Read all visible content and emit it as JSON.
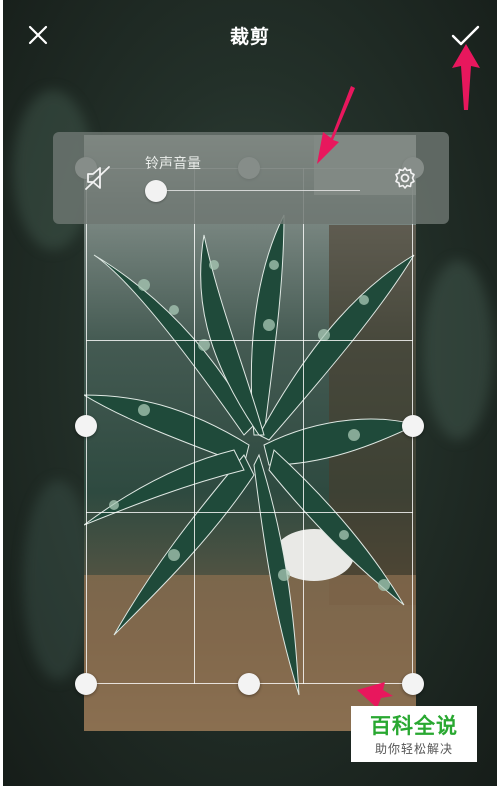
{
  "header": {
    "title": "裁剪",
    "close_icon": "close-icon",
    "confirm_icon": "checkmark-icon"
  },
  "volume_overlay": {
    "label": "铃声音量",
    "mute_icon": "speaker-muted-icon",
    "settings_icon": "gear-icon",
    "level": 0
  },
  "crop": {
    "grid": "3x3",
    "handles": [
      "top-left",
      "top-center",
      "top-right",
      "middle-left",
      "middle-right",
      "bottom-left",
      "bottom-center",
      "bottom-right"
    ]
  },
  "annotations": {
    "color": "#e8175d"
  },
  "watermark": {
    "main": "百科全说",
    "sub": "助你轻松解决",
    "color": "#29a831"
  }
}
